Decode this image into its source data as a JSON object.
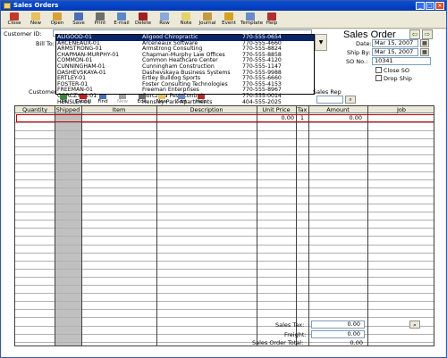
{
  "window": {
    "title": "Sales Orders"
  },
  "toolbar": {
    "buttons": [
      {
        "label": "Close",
        "color": "#c0392b"
      },
      {
        "label": "New",
        "color": "#e8c060"
      },
      {
        "label": "Open",
        "color": "#d9a03a"
      },
      {
        "label": "Save",
        "color": "#4a6fb8"
      },
      {
        "label": "Print",
        "color": "#6d6d6d"
      },
      {
        "label": "E-mail",
        "color": "#5c87c7"
      },
      {
        "label": "Delete",
        "color": "#a02020"
      },
      {
        "label": "Row",
        "color": "#8aa8d8"
      },
      {
        "label": "Note",
        "color": "#e5d36a"
      },
      {
        "label": "Journal",
        "color": "#c69a44"
      },
      {
        "label": "Event",
        "color": "#d6a020"
      },
      {
        "label": "Template",
        "color": "#6a8ac8"
      },
      {
        "label": "Help",
        "color": "#b03030"
      }
    ]
  },
  "header": {
    "customer_id_label": "Customer ID:",
    "bill_to_label": "Bill To:",
    "customer_label": "Customer",
    "sales_rep_label": "Sales Rep",
    "title": "Sales Order",
    "date_label": "Date:",
    "date_value": "Mar 15, 2007",
    "ship_by_label": "Ship By:",
    "ship_by_value": "Mar 15, 2007",
    "so_no_label": "SO No.:",
    "so_no_value": "10341",
    "close_so_label": "Close SO",
    "drop_ship_label": "Drop Ship"
  },
  "customer_dropdown": [
    {
      "id": "ALIGOOD-01",
      "name": "Aligood Chiropractic",
      "phone": "770-555-0654",
      "selected": true
    },
    {
      "id": "ARCENEAUX-01",
      "name": "Arceneaux Software",
      "phone": "770-555-4660"
    },
    {
      "id": "ARMSTRONG-01",
      "name": "Armstrong Consulting",
      "phone": "770-555-8824"
    },
    {
      "id": "CHAPMAN-MURPHY-01",
      "name": "Chapman-Murphy Law Offices",
      "phone": "770-555-8858"
    },
    {
      "id": "COMMON-01",
      "name": "Common Heathcare Center",
      "phone": "770-555-4120"
    },
    {
      "id": "CUNNINGHAM-01",
      "name": "Cunningham Construction",
      "phone": "770-555-1147"
    },
    {
      "id": "DASHEVSKAYA-01",
      "name": "Dashevskaya Business Systems",
      "phone": "770-555-9988"
    },
    {
      "id": "ERTLEY-01",
      "name": "Ertley Bulldog Sports",
      "phone": "770-555-6660"
    },
    {
      "id": "FOSTER-01",
      "name": "Foster Consulting Technologies",
      "phone": "770-555-4153"
    },
    {
      "id": "FREEMAN-01",
      "name": "Freeman Enterprises",
      "phone": "770-555-8967"
    },
    {
      "id": "GORCZYCA-01",
      "name": "Gorczyca Pest Control",
      "phone": "770-555-0014"
    },
    {
      "id": "HENSLEY-01",
      "name": "Hensley Park Apartments",
      "phone": "404-555-2025"
    }
  ],
  "mini_toolbar": [
    {
      "label": "OK",
      "color": "#3a8a3a"
    },
    {
      "label": "Cancel",
      "color": "#c02020"
    },
    {
      "label": "Find",
      "color": "#4a6fb8"
    },
    {
      "label": "New",
      "color": "#a0a0a0",
      "disabled": true
    },
    {
      "label": "Edit",
      "color": "#6a6a6a"
    },
    {
      "label": "New",
      "color": "#e8c060"
    },
    {
      "label": "Sort",
      "color": "#6a8ac8"
    },
    {
      "label": "Help",
      "color": "#b03030"
    }
  ],
  "grid": {
    "columns": [
      "Quantity",
      "Shipped",
      "Item",
      "Description",
      "Unit Price",
      "Tax",
      "Amount",
      "Job"
    ],
    "first_row": {
      "unit_price": "0.00",
      "tax": "1",
      "amount": "0.00"
    }
  },
  "totals": {
    "sales_tax_label": "Sales Tax:",
    "sales_tax_value": "0.00",
    "freight_label": "Freight:",
    "freight_value": "0.00",
    "total_label": "Sales Order Total:",
    "total_value": "0.00"
  }
}
